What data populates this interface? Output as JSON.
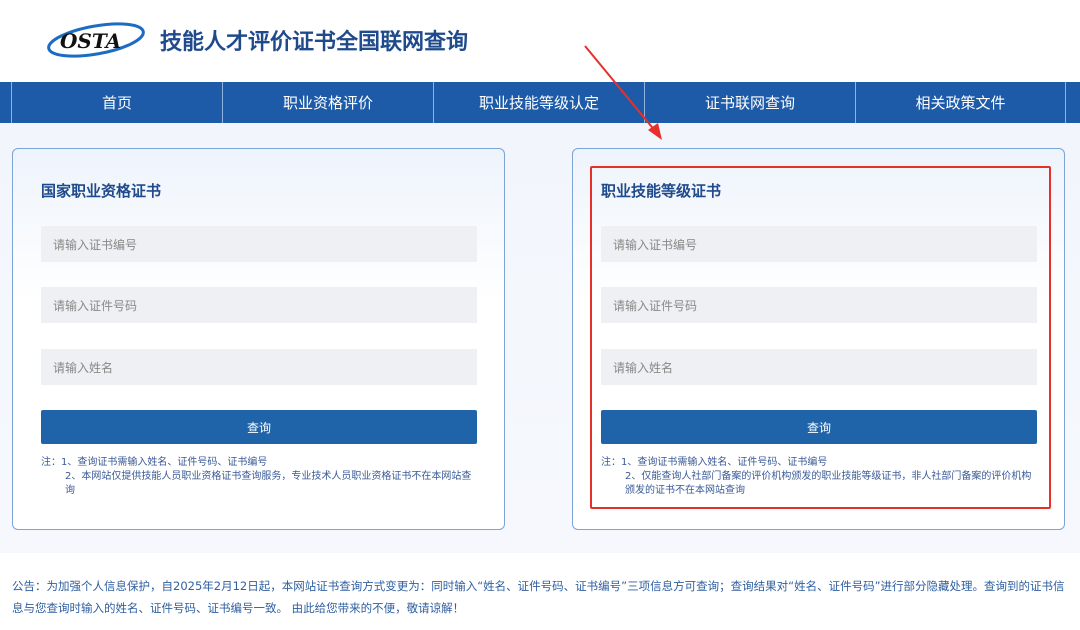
{
  "header": {
    "logo_text": "OSTA",
    "title": "技能人才评价证书全国联网查询"
  },
  "nav": {
    "items": [
      "首页",
      "职业资格评价",
      "职业技能等级认定",
      "证书联网查询",
      "相关政策文件"
    ]
  },
  "cards": [
    {
      "title": "国家职业资格证书",
      "placeholders": [
        "请输入证书编号",
        "请输入证件号码",
        "请输入姓名"
      ],
      "button": "查询",
      "note_prefix": "注：",
      "notes": [
        "1、查询证书需输入姓名、证件号码、证书编号",
        "2、本网站仅提供技能人员职业资格证书查询服务，专业技术人员职业资格证书不在本网站查询"
      ]
    },
    {
      "title": "职业技能等级证书",
      "placeholders": [
        "请输入证书编号",
        "请输入证件号码",
        "请输入姓名"
      ],
      "button": "查询",
      "note_prefix": "注：",
      "notes": [
        "1、查询证书需输入姓名、证件号码、证书编号",
        "2、仅能查询人社部门备案的评价机构颁发的职业技能等级证书，非人社部门备案的评价机构颁发的证书不在本网站查询"
      ]
    }
  ],
  "notice": "公告：为加强个人信息保护，自2025年2月12日起，本网站证书查询方式变更为：同时输入“姓名、证件号码、证书编号”三项信息方可查询；查询结果对“姓名、证件号码”进行部分隐藏处理。查询到的证书信息与您查询时输入的姓名、证件号码、证书编号一致。 由此给您带来的不便，敬请谅解！",
  "colors": {
    "nav": "#1d5ba8",
    "highlight": "#e8302a"
  }
}
